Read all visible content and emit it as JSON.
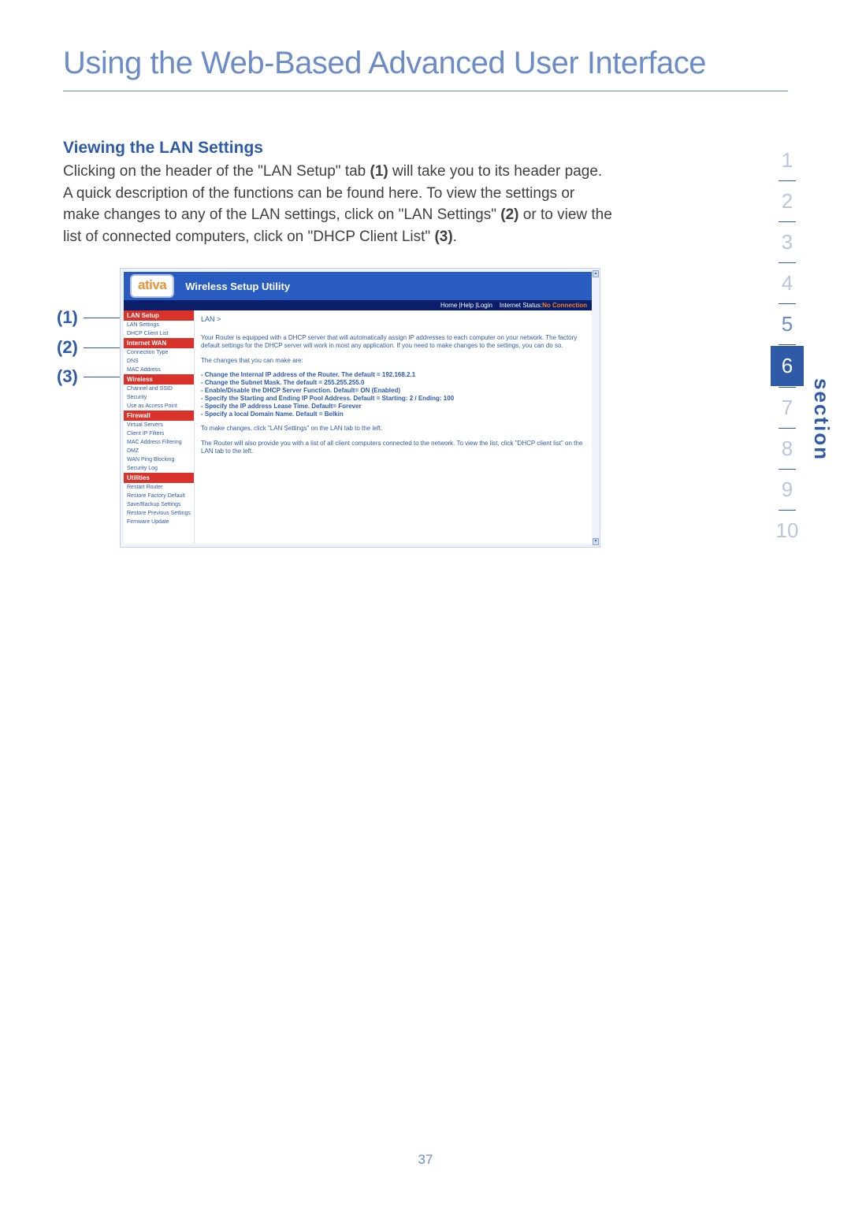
{
  "page": {
    "title": "Using the Web-Based Advanced User Interface",
    "section_heading": "Viewing the LAN Settings",
    "body_segments": [
      "Clicking on the header of the \"LAN Setup\" tab ",
      "(1)",
      " will take you to its header page. A quick description of the functions can be found here. To view the settings or make changes to any of the LAN settings, click on \"LAN Settings\" ",
      "(2)",
      " or to view the list of connected computers, click on \"DHCP Client List\" ",
      "(3)",
      "."
    ],
    "page_number": "37",
    "section_label": "section"
  },
  "callouts": {
    "c1": "(1)",
    "c2": "(2)",
    "c3": "(3)"
  },
  "sidenav": {
    "items": [
      "1",
      "2",
      "3",
      "4",
      "5",
      "6",
      "7",
      "8",
      "9",
      "10"
    ],
    "active_index": 5
  },
  "router": {
    "logo": "ativa",
    "utility_title": "Wireless Setup Utility",
    "status": {
      "links": "Home |Help |Login",
      "label": "Internet Status:",
      "value": "No Connection"
    },
    "breadcrumb": "LAN >",
    "sidebar": [
      {
        "type": "header",
        "label": "LAN Setup"
      },
      {
        "type": "item",
        "label": "LAN Settings"
      },
      {
        "type": "item",
        "label": "DHCP Client List"
      },
      {
        "type": "header",
        "label": "Internet WAN"
      },
      {
        "type": "item",
        "label": "Connection Type"
      },
      {
        "type": "item",
        "label": "DNS"
      },
      {
        "type": "item",
        "label": "MAC Address"
      },
      {
        "type": "header",
        "label": "Wireless"
      },
      {
        "type": "item",
        "label": "Channel and SSID"
      },
      {
        "type": "item",
        "label": "Security"
      },
      {
        "type": "item",
        "label": "Use as Access Point"
      },
      {
        "type": "header",
        "label": "Firewall"
      },
      {
        "type": "item",
        "label": "Virtual Servers"
      },
      {
        "type": "item",
        "label": "Client IP Filters"
      },
      {
        "type": "item",
        "label": "MAC Address Filtering"
      },
      {
        "type": "item",
        "label": "DMZ"
      },
      {
        "type": "item",
        "label": "WAN Ping Blocking"
      },
      {
        "type": "item",
        "label": "Security Log"
      },
      {
        "type": "header",
        "label": "Utilities"
      },
      {
        "type": "item",
        "label": "Restart Router"
      },
      {
        "type": "item",
        "label": "Restore Factory Default"
      },
      {
        "type": "item",
        "label": "Save/Backup Settings"
      },
      {
        "type": "item",
        "label": "Restore Previous Settings"
      },
      {
        "type": "item",
        "label": "Firmware Update"
      }
    ],
    "main": {
      "p1": "Your Router is equipped with a DHCP server that will automatically assign IP addresses to each computer on your network. The factory default settings for the DHCP server will work in most any application. If you need to make changes to the settings, you can do so.",
      "p2": "The changes that you can make are:",
      "bullets": [
        "- Change the Internal IP address of the Router. The default = 192.168.2.1",
        "- Change the Subnet Mask. The default = 255.255.255.0",
        "- Enable/Disable the DHCP Server Function. Default= ON (Enabled)",
        "- Specify the Starting and Ending IP Pool Address. Default = Starting: 2 / Ending: 100",
        "- Specify the IP address Lease Time. Default= Forever",
        "- Specify a local Domain Name. Default = Belkin"
      ],
      "p3": "To make changes, click \"LAN Settings\" on the LAN tab to the left.",
      "p4": "The Router will also provide you with a list of all client computers connected to the network. To view the list, click \"DHCP client list\" on the LAN tab to the left."
    }
  }
}
